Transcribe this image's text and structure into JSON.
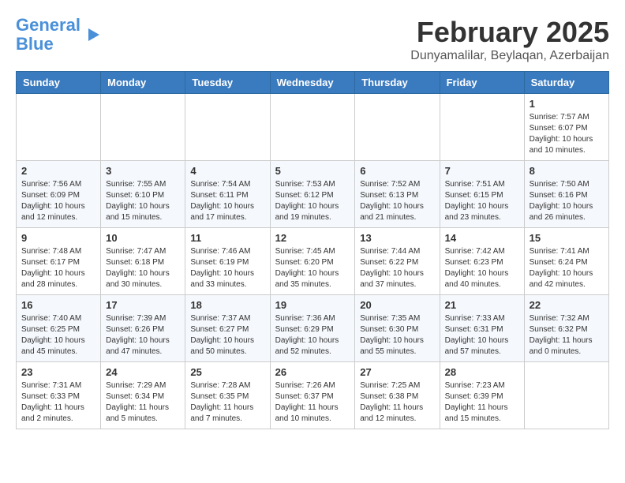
{
  "header": {
    "logo_line1": "General",
    "logo_line2": "Blue",
    "month_year": "February 2025",
    "location": "Dunyamalilar, Beylaqan, Azerbaijan"
  },
  "days_of_week": [
    "Sunday",
    "Monday",
    "Tuesday",
    "Wednesday",
    "Thursday",
    "Friday",
    "Saturday"
  ],
  "weeks": [
    [
      {
        "day": "",
        "info": ""
      },
      {
        "day": "",
        "info": ""
      },
      {
        "day": "",
        "info": ""
      },
      {
        "day": "",
        "info": ""
      },
      {
        "day": "",
        "info": ""
      },
      {
        "day": "",
        "info": ""
      },
      {
        "day": "1",
        "info": "Sunrise: 7:57 AM\nSunset: 6:07 PM\nDaylight: 10 hours and 10 minutes."
      }
    ],
    [
      {
        "day": "2",
        "info": "Sunrise: 7:56 AM\nSunset: 6:09 PM\nDaylight: 10 hours and 12 minutes."
      },
      {
        "day": "3",
        "info": "Sunrise: 7:55 AM\nSunset: 6:10 PM\nDaylight: 10 hours and 15 minutes."
      },
      {
        "day": "4",
        "info": "Sunrise: 7:54 AM\nSunset: 6:11 PM\nDaylight: 10 hours and 17 minutes."
      },
      {
        "day": "5",
        "info": "Sunrise: 7:53 AM\nSunset: 6:12 PM\nDaylight: 10 hours and 19 minutes."
      },
      {
        "day": "6",
        "info": "Sunrise: 7:52 AM\nSunset: 6:13 PM\nDaylight: 10 hours and 21 minutes."
      },
      {
        "day": "7",
        "info": "Sunrise: 7:51 AM\nSunset: 6:15 PM\nDaylight: 10 hours and 23 minutes."
      },
      {
        "day": "8",
        "info": "Sunrise: 7:50 AM\nSunset: 6:16 PM\nDaylight: 10 hours and 26 minutes."
      }
    ],
    [
      {
        "day": "9",
        "info": "Sunrise: 7:48 AM\nSunset: 6:17 PM\nDaylight: 10 hours and 28 minutes."
      },
      {
        "day": "10",
        "info": "Sunrise: 7:47 AM\nSunset: 6:18 PM\nDaylight: 10 hours and 30 minutes."
      },
      {
        "day": "11",
        "info": "Sunrise: 7:46 AM\nSunset: 6:19 PM\nDaylight: 10 hours and 33 minutes."
      },
      {
        "day": "12",
        "info": "Sunrise: 7:45 AM\nSunset: 6:20 PM\nDaylight: 10 hours and 35 minutes."
      },
      {
        "day": "13",
        "info": "Sunrise: 7:44 AM\nSunset: 6:22 PM\nDaylight: 10 hours and 37 minutes."
      },
      {
        "day": "14",
        "info": "Sunrise: 7:42 AM\nSunset: 6:23 PM\nDaylight: 10 hours and 40 minutes."
      },
      {
        "day": "15",
        "info": "Sunrise: 7:41 AM\nSunset: 6:24 PM\nDaylight: 10 hours and 42 minutes."
      }
    ],
    [
      {
        "day": "16",
        "info": "Sunrise: 7:40 AM\nSunset: 6:25 PM\nDaylight: 10 hours and 45 minutes."
      },
      {
        "day": "17",
        "info": "Sunrise: 7:39 AM\nSunset: 6:26 PM\nDaylight: 10 hours and 47 minutes."
      },
      {
        "day": "18",
        "info": "Sunrise: 7:37 AM\nSunset: 6:27 PM\nDaylight: 10 hours and 50 minutes."
      },
      {
        "day": "19",
        "info": "Sunrise: 7:36 AM\nSunset: 6:29 PM\nDaylight: 10 hours and 52 minutes."
      },
      {
        "day": "20",
        "info": "Sunrise: 7:35 AM\nSunset: 6:30 PM\nDaylight: 10 hours and 55 minutes."
      },
      {
        "day": "21",
        "info": "Sunrise: 7:33 AM\nSunset: 6:31 PM\nDaylight: 10 hours and 57 minutes."
      },
      {
        "day": "22",
        "info": "Sunrise: 7:32 AM\nSunset: 6:32 PM\nDaylight: 11 hours and 0 minutes."
      }
    ],
    [
      {
        "day": "23",
        "info": "Sunrise: 7:31 AM\nSunset: 6:33 PM\nDaylight: 11 hours and 2 minutes."
      },
      {
        "day": "24",
        "info": "Sunrise: 7:29 AM\nSunset: 6:34 PM\nDaylight: 11 hours and 5 minutes."
      },
      {
        "day": "25",
        "info": "Sunrise: 7:28 AM\nSunset: 6:35 PM\nDaylight: 11 hours and 7 minutes."
      },
      {
        "day": "26",
        "info": "Sunrise: 7:26 AM\nSunset: 6:37 PM\nDaylight: 11 hours and 10 minutes."
      },
      {
        "day": "27",
        "info": "Sunrise: 7:25 AM\nSunset: 6:38 PM\nDaylight: 11 hours and 12 minutes."
      },
      {
        "day": "28",
        "info": "Sunrise: 7:23 AM\nSunset: 6:39 PM\nDaylight: 11 hours and 15 minutes."
      },
      {
        "day": "",
        "info": ""
      }
    ]
  ]
}
